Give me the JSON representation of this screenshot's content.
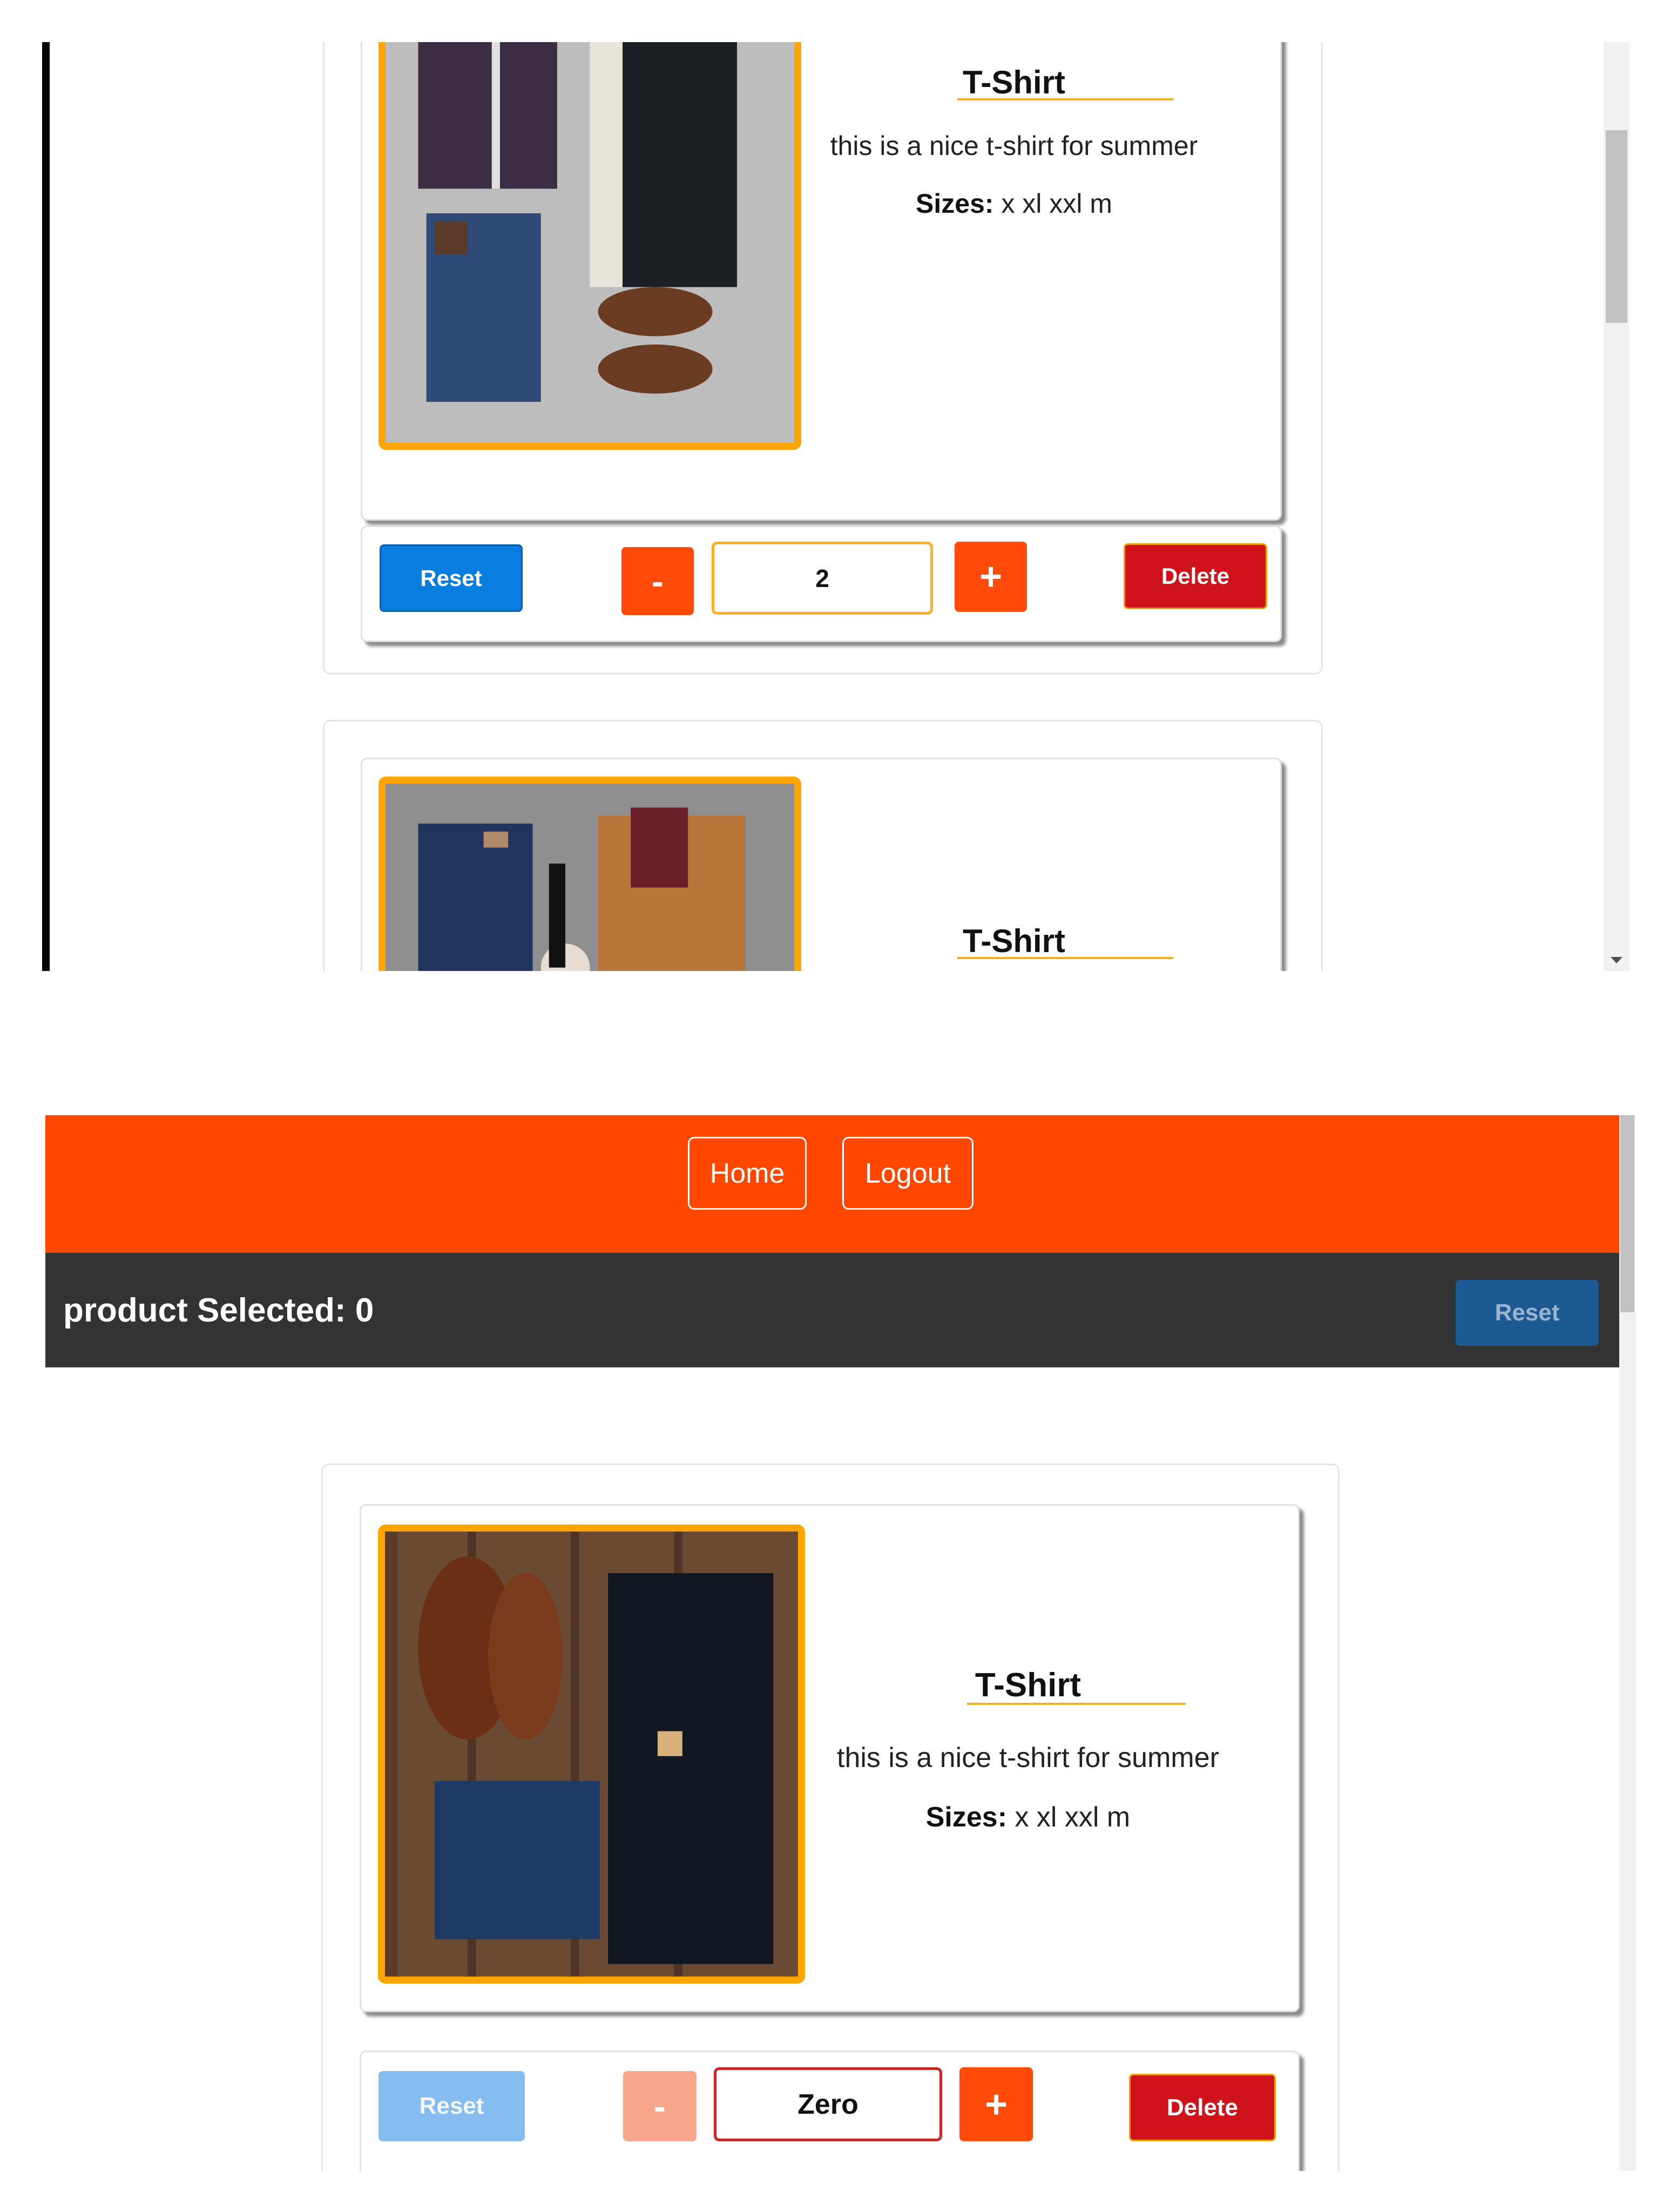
{
  "panel_top": {
    "product_1": {
      "title": "T-Shirt",
      "description": "this is a nice t-shirt for summer",
      "sizes_label": "Sizes:",
      "sizes_value": "x xl xxl m",
      "image": "outfit-photo-shirt-jacket-jeans-boots"
    },
    "controls_1": {
      "reset_label": "Reset",
      "minus_label": "-",
      "quantity": "2",
      "plus_label": "+",
      "delete_label": "Delete"
    },
    "product_2": {
      "title": "T-Shirt",
      "image": "outfit-photo-jeans-jacket-coffee"
    }
  },
  "panel_bottom": {
    "nav": {
      "home_label": "Home",
      "logout_label": "Logout"
    },
    "summary": {
      "label": "product Selected: 0",
      "reset_label": "Reset"
    },
    "product_1": {
      "title": "T-Shirt",
      "description": "this is a nice t-shirt for summer",
      "sizes_label": "Sizes:",
      "sizes_value": "x xl xxl m",
      "image": "outfit-photo-boots-jeans-jacket-wood"
    },
    "controls_1": {
      "reset_label": "Reset",
      "minus_label": "-",
      "quantity": "Zero",
      "plus_label": "+",
      "delete_label": "Delete"
    }
  },
  "colors": {
    "accent_orange": "#ffa500",
    "navbar": "#ff4700",
    "subbar": "#333333",
    "reset_blue": "#0a7ee0",
    "delete_red": "#d0121a"
  }
}
